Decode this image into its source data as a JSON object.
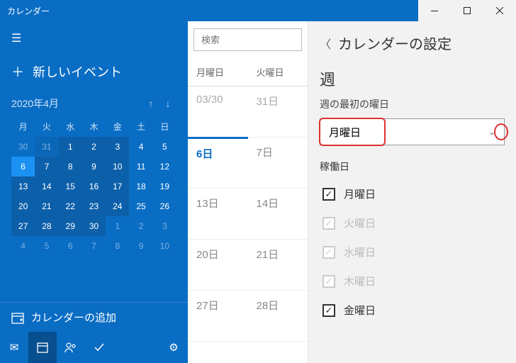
{
  "title": "カレンダー",
  "sidebar": {
    "new_event": "新しいイベント",
    "month_label": "2020年4月",
    "weekdays": [
      "月",
      "火",
      "水",
      "木",
      "金",
      "土",
      "日"
    ],
    "grid": [
      [
        {
          "d": "30",
          "cls": "dim"
        },
        {
          "d": "31",
          "cls": "dim shade"
        },
        {
          "d": "1",
          "cls": "shade"
        },
        {
          "d": "2",
          "cls": "shade"
        },
        {
          "d": "3",
          "cls": "shade"
        },
        {
          "d": "4",
          "cls": ""
        },
        {
          "d": "5",
          "cls": ""
        }
      ],
      [
        {
          "d": "6",
          "cls": "today sel"
        },
        {
          "d": "7",
          "cls": "shade"
        },
        {
          "d": "8",
          "cls": "shade"
        },
        {
          "d": "9",
          "cls": "shade"
        },
        {
          "d": "10",
          "cls": "shade"
        },
        {
          "d": "11",
          "cls": ""
        },
        {
          "d": "12",
          "cls": ""
        }
      ],
      [
        {
          "d": "13",
          "cls": "shade"
        },
        {
          "d": "14",
          "cls": "shade"
        },
        {
          "d": "15",
          "cls": "shade"
        },
        {
          "d": "16",
          "cls": "shade"
        },
        {
          "d": "17",
          "cls": "shade"
        },
        {
          "d": "18",
          "cls": ""
        },
        {
          "d": "19",
          "cls": ""
        }
      ],
      [
        {
          "d": "20",
          "cls": "shade"
        },
        {
          "d": "21",
          "cls": "shade"
        },
        {
          "d": "22",
          "cls": "shade"
        },
        {
          "d": "23",
          "cls": "shade"
        },
        {
          "d": "24",
          "cls": "shade"
        },
        {
          "d": "25",
          "cls": ""
        },
        {
          "d": "26",
          "cls": ""
        }
      ],
      [
        {
          "d": "27",
          "cls": "shade"
        },
        {
          "d": "28",
          "cls": "shade"
        },
        {
          "d": "29",
          "cls": "shade"
        },
        {
          "d": "30",
          "cls": "shade"
        },
        {
          "d": "1",
          "cls": "dim"
        },
        {
          "d": "2",
          "cls": "dim"
        },
        {
          "d": "3",
          "cls": "dim"
        }
      ],
      [
        {
          "d": "4",
          "cls": "dim"
        },
        {
          "d": "5",
          "cls": "dim"
        },
        {
          "d": "6",
          "cls": "dim"
        },
        {
          "d": "7",
          "cls": "dim"
        },
        {
          "d": "8",
          "cls": "dim"
        },
        {
          "d": "9",
          "cls": "dim"
        },
        {
          "d": "10",
          "cls": "dim"
        }
      ]
    ],
    "add_calendar": "カレンダーの追加"
  },
  "center": {
    "search_placeholder": "検索",
    "headers": [
      "月曜日",
      "火曜日"
    ],
    "rows": [
      [
        "03/30",
        "31日"
      ],
      [
        "6日",
        "7日"
      ],
      [
        "13日",
        "14日"
      ],
      [
        "20日",
        "21日"
      ],
      [
        "27日",
        "28日"
      ]
    ]
  },
  "panel": {
    "title": "カレンダーの設定",
    "week_heading": "週",
    "first_day_label": "週の最初の曜日",
    "first_day_value": "月曜日",
    "workdays_label": "稼働日",
    "days": [
      {
        "label": "月曜日",
        "checked": true,
        "enabled": true
      },
      {
        "label": "火曜日",
        "checked": true,
        "enabled": false
      },
      {
        "label": "水曜日",
        "checked": true,
        "enabled": false
      },
      {
        "label": "木曜日",
        "checked": true,
        "enabled": false
      },
      {
        "label": "金曜日",
        "checked": true,
        "enabled": true
      }
    ]
  }
}
